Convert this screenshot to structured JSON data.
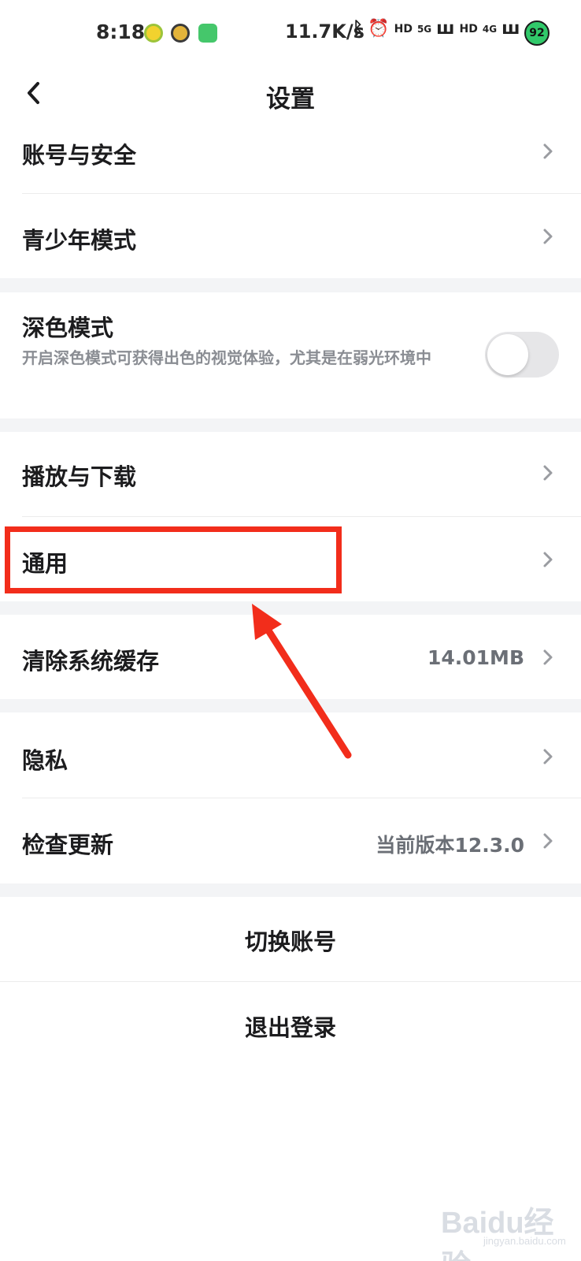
{
  "status_bar": {
    "time": "8:18",
    "net_speed": "11.7K/s",
    "signal_glyphs": [
      "5G",
      "4G"
    ],
    "battery": "92"
  },
  "header": {
    "title": "设置",
    "back_icon": "chevron-left-icon"
  },
  "rows": {
    "account_security": "账号与安全",
    "teen_mode": "青少年模式",
    "dark_mode": {
      "label": "深色模式",
      "description": "开启深色模式可获得出色的视觉体验，尤其是在弱光环境中",
      "enabled": false
    },
    "play_download": "播放与下载",
    "general": "通用",
    "clear_cache": {
      "label": "清除系统缓存",
      "value": "14.01MB"
    },
    "privacy": "隐私",
    "check_update": {
      "label": "检查更新",
      "value": "当前版本12.3.0"
    }
  },
  "actions": {
    "switch_account": "切换账号",
    "logout": "退出登录"
  },
  "annotation": {
    "color": "#f22d1b"
  },
  "watermark": {
    "brand": "Baidu经验",
    "url": "jingyan.baidu.com"
  }
}
